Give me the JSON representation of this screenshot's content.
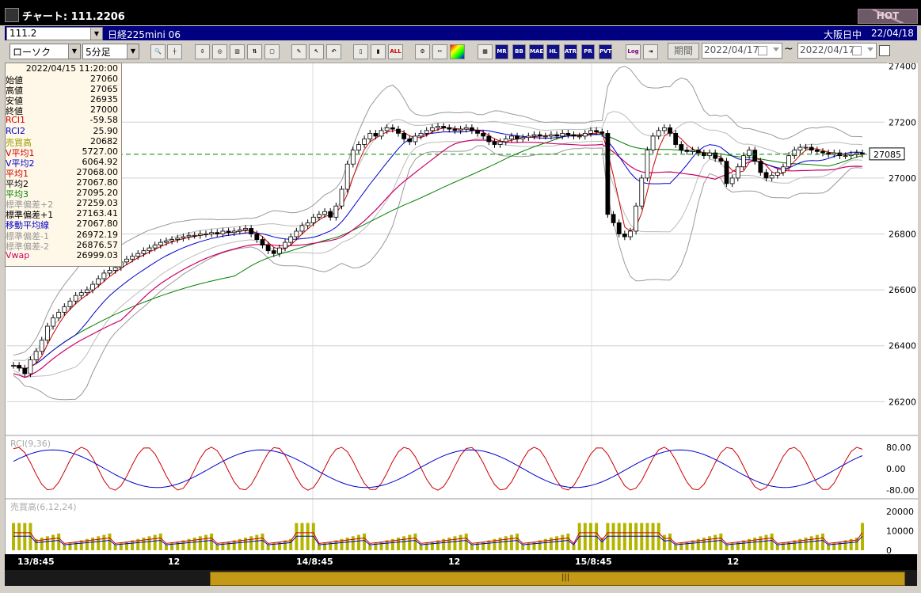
{
  "window": {
    "title": "チャート: 111.2206",
    "hot_label": "HOT"
  },
  "codebar": {
    "code": "111.2",
    "instrument": "日経225mini 06",
    "market": "大阪日中",
    "date": "22/04/18"
  },
  "toolbar": {
    "chart_type": "ローソク",
    "interval": "5分足",
    "icons": [
      "zoom-icon",
      "crosshair-icon",
      "down-arrow-icon",
      "search-chart-icon",
      "indicator-icon",
      "split-icon",
      "lock-icon",
      "pen-icon",
      "pointer-icon",
      "undo-icon",
      "candle-icon",
      "bar-icon",
      "all-icon",
      "gear-icon",
      "wrench-icon",
      "color-icon"
    ],
    "all_label": "ALL",
    "indicator_buttons": [
      "MA",
      "MR",
      "BB",
      "MAE",
      "HL",
      "ATR",
      "PR",
      "PVT"
    ],
    "log_label": "Log",
    "period_label": "期間",
    "date_from": "2022/04/17",
    "date_to": "2022/04/17",
    "tilde": "~"
  },
  "info": {
    "timestamp": "2022/04/15  11:20:00",
    "rows": [
      {
        "label": "始値",
        "value": "27060",
        "color": "#000000"
      },
      {
        "label": "高値",
        "value": "27065",
        "color": "#000000"
      },
      {
        "label": "安値",
        "value": "26935",
        "color": "#000000"
      },
      {
        "label": "終値",
        "value": "27000",
        "color": "#000000"
      },
      {
        "label": "RCI1",
        "value": "-59.58",
        "color": "#cc0000"
      },
      {
        "label": "RCI2",
        "value": "25.90",
        "color": "#0000cc"
      },
      {
        "label": "売買高",
        "value": "20682",
        "color": "#999900"
      },
      {
        "label": "V平均1",
        "value": "5727.00",
        "color": "#cc0000"
      },
      {
        "label": "V平均2",
        "value": "6064.92",
        "color": "#0000cc"
      },
      {
        "label": "平均1",
        "value": "27068.00",
        "color": "#cc0000"
      },
      {
        "label": "平均2",
        "value": "27067.80",
        "color": "#000000"
      },
      {
        "label": "平均3",
        "value": "27095.20",
        "color": "#008000"
      },
      {
        "label": "標準偏差+2",
        "value": "27259.03",
        "color": "#999999"
      },
      {
        "label": "標準偏差+1",
        "value": "27163.41",
        "color": "#000000"
      },
      {
        "label": "移動平均線",
        "value": "27067.80",
        "color": "#0000cc"
      },
      {
        "label": "標準偏差-1",
        "value": "26972.19",
        "color": "#999999"
      },
      {
        "label": "標準偏差-2",
        "value": "26876.57",
        "color": "#999999"
      },
      {
        "label": "Vwap",
        "value": "26999.03",
        "color": "#cc0066"
      }
    ]
  },
  "price_axis": {
    "ticks": [
      "27400",
      "27200",
      "27000",
      "26800",
      "26600",
      "26400",
      "26200"
    ],
    "current": "27085"
  },
  "rci_panel": {
    "label": "RCI(9,36)",
    "ticks": [
      "80.00",
      "0.00",
      "-80.00"
    ]
  },
  "volume_panel": {
    "label": "売買高(6,12,24)",
    "ticks": [
      "20000",
      "10000",
      "0"
    ]
  },
  "x_axis": {
    "labels": [
      "13/8:45",
      "12",
      "14/8:45",
      "12",
      "15/8:45",
      "12"
    ]
  },
  "colors": {
    "up_candle": "#ffffff",
    "down_candle": "#000000",
    "ma_short": "#cc0000",
    "ma_mid": "#0000cc",
    "ma_long": "#008000",
    "vwap": "#cc0066",
    "volume": "#b5b500",
    "bollinger": "#999999"
  },
  "chart_data": {
    "type": "candlestick",
    "ylim": [
      26150,
      27450
    ],
    "price_series": [
      26330,
      26320,
      26300,
      26350,
      26380,
      26420,
      26470,
      26500,
      26520,
      26540,
      26560,
      26580,
      26590,
      26600,
      26620,
      26640,
      26660,
      26670,
      26680,
      26700,
      26710,
      26720,
      26730,
      26740,
      26750,
      26760,
      26770,
      26775,
      26780,
      26785,
      26790,
      26795,
      26795,
      26800,
      26800,
      26805,
      26800,
      26810,
      26805,
      26810,
      26815,
      26820,
      26800,
      26780,
      26760,
      26740,
      26730,
      26750,
      26770,
      26790,
      26810,
      26830,
      26840,
      26860,
      26870,
      26880,
      26860,
      26900,
      26960,
      27050,
      27100,
      27120,
      27140,
      27160,
      27150,
      27170,
      27180,
      27175,
      27160,
      27140,
      27130,
      27150,
      27160,
      27170,
      27180,
      27185,
      27180,
      27175,
      27170,
      27175,
      27180,
      27170,
      27160,
      27150,
      27130,
      27120,
      27130,
      27140,
      27150,
      27140,
      27145,
      27150,
      27155,
      27150,
      27150,
      27155,
      27150,
      27160,
      27155,
      27150,
      27150,
      27160,
      27170,
      27165,
      27160,
      26870,
      26840,
      26800,
      26790,
      26810,
      26900,
      27000,
      27100,
      27150,
      27170,
      27180,
      27160,
      27120,
      27100,
      27095,
      27100,
      27090,
      27080,
      27090,
      27070,
      27060,
      26980,
      27000,
      27040,
      27080,
      27100,
      27060,
      27020,
      27000,
      27010,
      27020,
      27040,
      27080,
      27100,
      27110,
      27110,
      27100,
      27095,
      27090,
      27085,
      27090,
      27080,
      27080,
      27085,
      27090,
      27085
    ],
    "rci1_end": -59.58,
    "rci2_end": 25.9,
    "volume_end": 20682
  }
}
